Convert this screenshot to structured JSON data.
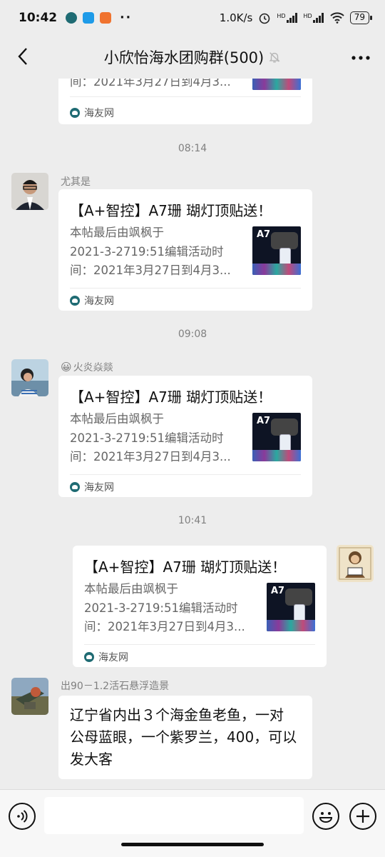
{
  "status_bar": {
    "time": "10:42",
    "dots": "··",
    "net_speed": "1.0K/s",
    "signal1_label": "HD",
    "signal2_label": "HD",
    "battery": "79",
    "icons": [
      "whatsapp-icon",
      "blue-app-icon",
      "orange-app-icon",
      "alarm-icon",
      "signal-icon",
      "wifi-icon",
      "battery-icon"
    ]
  },
  "header": {
    "title": "小欣怡海水团购群(500)",
    "icons": [
      "back-arrow-icon",
      "mute-bell-icon",
      "more-icon"
    ]
  },
  "timestamps": [
    "08:14",
    "09:08",
    "10:41"
  ],
  "senders": {
    "s1": "尤其是",
    "s2_emoji": "😀",
    "s2": "火炎焱燚",
    "s3": "出90－1.2活石悬浮造景"
  },
  "cards": {
    "title": "【A+智控】A7珊 瑚灯顶贴送！",
    "desc_line1": "本帖最后由飒枫于",
    "desc_line2": "2021-3-2719:51编辑活动时",
    "desc_line3": "间：2021年3月27日到4月3...",
    "source": "海友网",
    "thumb_label": "A7"
  },
  "text_message": {
    "line1": "辽宁省内出３个海金鱼老鱼，一对",
    "line2": "公母蓝眼，一个紫罗兰，400，可以",
    "line3": "发大客"
  },
  "input_bar": {
    "placeholder": "",
    "icons": [
      "voice-icon",
      "emoji-icon",
      "plus-icon"
    ]
  }
}
